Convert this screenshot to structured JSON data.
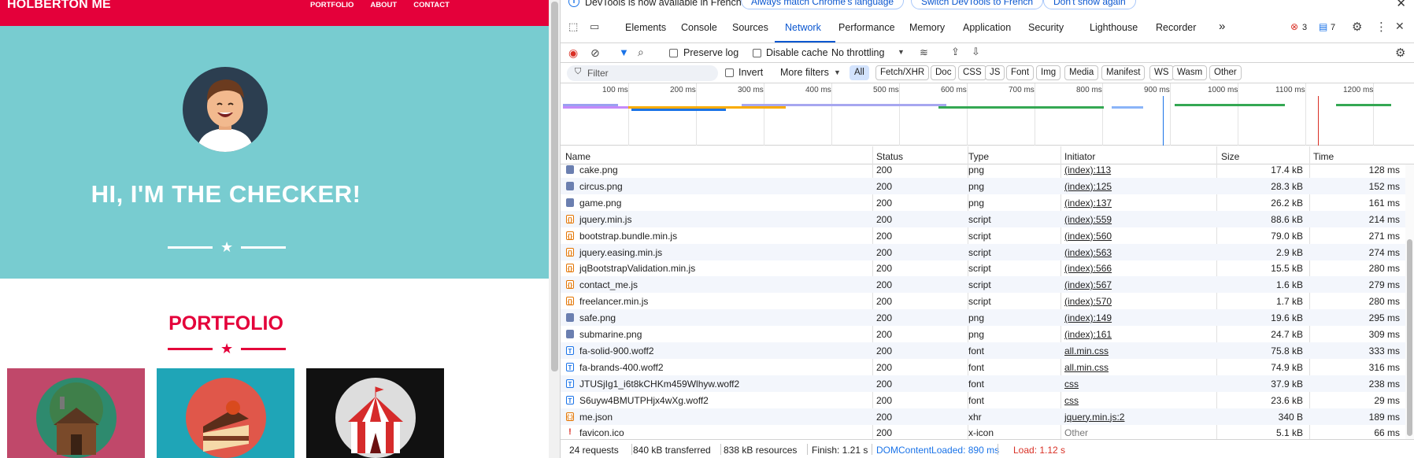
{
  "site": {
    "brand": "HOLBERTON ME",
    "nav": [
      "PORTFOLIO",
      "ABOUT",
      "CONTACT"
    ],
    "hero_title": "HI, I'M THE CHECKER!",
    "portfolio_title": "PORTFOLIO",
    "colors": {
      "primary": "#e4003a",
      "hero_bg": "#78ccd0",
      "avatar_bg": "#2c3e50"
    }
  },
  "devtools": {
    "infobar": {
      "text": "DevTools is now available in French!",
      "btn_match": "Always match Chrome's language",
      "btn_switch": "Switch DevTools to French",
      "btn_dismiss": "Don't show again"
    },
    "tabs": [
      "Elements",
      "Console",
      "Sources",
      "Network",
      "Performance",
      "Memory",
      "Application",
      "Security",
      "Lighthouse",
      "Recorder"
    ],
    "active_tab": "Network",
    "more_tabs": "»",
    "errors_count": "3",
    "messages_count": "7",
    "toolbar": {
      "preserve_log": "Preserve log",
      "disable_cache": "Disable cache",
      "throttling": "No throttling"
    },
    "filter": {
      "placeholder": "Filter",
      "invert": "Invert",
      "more_filters": "More filters",
      "chips": [
        "All",
        "Fetch/XHR",
        "Doc",
        "CSS",
        "JS",
        "Font",
        "Img",
        "Media",
        "Manifest",
        "WS",
        "Wasm",
        "Other"
      ]
    },
    "timeline_ticks": [
      "100 ms",
      "200 ms",
      "300 ms",
      "400 ms",
      "500 ms",
      "600 ms",
      "700 ms",
      "800 ms",
      "900 ms",
      "1000 ms",
      "1100 ms",
      "1200 ms"
    ],
    "columns": [
      "Name",
      "Status",
      "Type",
      "Initiator",
      "Size",
      "Time"
    ],
    "rows": [
      {
        "name": "cake.png",
        "status": "200",
        "type": "png",
        "initiator": "(index):113",
        "size": "17.4 kB",
        "time": "128 ms",
        "icon": "png-icon"
      },
      {
        "name": "circus.png",
        "status": "200",
        "type": "png",
        "initiator": "(index):125",
        "size": "28.3 kB",
        "time": "152 ms",
        "icon": "png-icon"
      },
      {
        "name": "game.png",
        "status": "200",
        "type": "png",
        "initiator": "(index):137",
        "size": "26.2 kB",
        "time": "161 ms",
        "icon": "png-icon"
      },
      {
        "name": "jquery.min.js",
        "status": "200",
        "type": "script",
        "initiator": "(index):559",
        "size": "88.6 kB",
        "time": "214 ms",
        "icon": "script-icon"
      },
      {
        "name": "bootstrap.bundle.min.js",
        "status": "200",
        "type": "script",
        "initiator": "(index):560",
        "size": "79.0 kB",
        "time": "271 ms",
        "icon": "script-icon"
      },
      {
        "name": "jquery.easing.min.js",
        "status": "200",
        "type": "script",
        "initiator": "(index):563",
        "size": "2.9 kB",
        "time": "274 ms",
        "icon": "script-icon"
      },
      {
        "name": "jqBootstrapValidation.min.js",
        "status": "200",
        "type": "script",
        "initiator": "(index):566",
        "size": "15.5 kB",
        "time": "280 ms",
        "icon": "script-icon"
      },
      {
        "name": "contact_me.js",
        "status": "200",
        "type": "script",
        "initiator": "(index):567",
        "size": "1.6 kB",
        "time": "279 ms",
        "icon": "script-icon"
      },
      {
        "name": "freelancer.min.js",
        "status": "200",
        "type": "script",
        "initiator": "(index):570",
        "size": "1.7 kB",
        "time": "280 ms",
        "icon": "script-icon"
      },
      {
        "name": "safe.png",
        "status": "200",
        "type": "png",
        "initiator": "(index):149",
        "size": "19.6 kB",
        "time": "295 ms",
        "icon": "png-icon"
      },
      {
        "name": "submarine.png",
        "status": "200",
        "type": "png",
        "initiator": "(index):161",
        "size": "24.7 kB",
        "time": "309 ms",
        "icon": "png-icon"
      },
      {
        "name": "fa-solid-900.woff2",
        "status": "200",
        "type": "font",
        "initiator": "all.min.css",
        "size": "75.8 kB",
        "time": "333 ms",
        "icon": "font-icon"
      },
      {
        "name": "fa-brands-400.woff2",
        "status": "200",
        "type": "font",
        "initiator": "all.min.css",
        "size": "74.9 kB",
        "time": "316 ms",
        "icon": "font-icon"
      },
      {
        "name": "JTUSjIg1_i6t8kCHKm459Wlhyw.woff2",
        "status": "200",
        "type": "font",
        "initiator": "css",
        "size": "37.9 kB",
        "time": "238 ms",
        "icon": "font-icon"
      },
      {
        "name": "S6uyw4BMUTPHjx4wXg.woff2",
        "status": "200",
        "type": "font",
        "initiator": "css",
        "size": "23.6 kB",
        "time": "29 ms",
        "icon": "font-icon"
      },
      {
        "name": "me.json",
        "status": "200",
        "type": "xhr",
        "initiator": "jquery.min.js:2",
        "size": "340 B",
        "time": "189 ms",
        "icon": "xhr-icon"
      },
      {
        "name": "favicon.ico",
        "status": "200",
        "type": "x-icon",
        "initiator": "Other",
        "size": "5.1 kB",
        "time": "66 ms",
        "icon": "ico-icon"
      }
    ],
    "status": {
      "requests": "24 requests",
      "transferred": "840 kB transferred",
      "resources": "838 kB resources",
      "finish": "Finish: 1.21 s",
      "dcl": "DOMContentLoaded: 890 ms",
      "load": "Load: 1.12 s",
      "dcl_color": "#1a73e8",
      "load_color": "#d93025"
    }
  }
}
